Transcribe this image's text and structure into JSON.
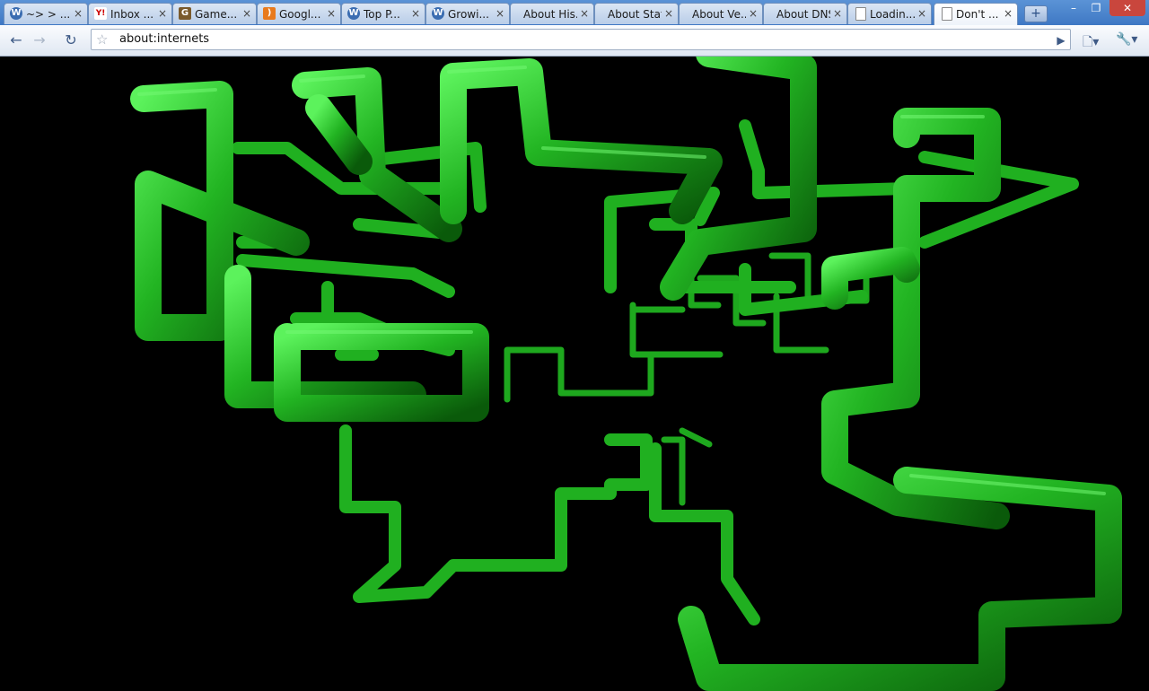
{
  "browser": {
    "tabs": [
      {
        "favicon": "wordpress-icon",
        "label": "~> > ...",
        "active": false
      },
      {
        "favicon": "yahoo-mail-icon",
        "label": "Inbox ...",
        "active": false
      },
      {
        "favicon": "gamer-icon",
        "label": "Game...",
        "active": false
      },
      {
        "favicon": "google-reader-icon",
        "label": "Googl...",
        "active": false
      },
      {
        "favicon": "wordpress-icon",
        "label": "Top P...",
        "active": false
      },
      {
        "favicon": "wordpress-icon",
        "label": "Growi...",
        "active": false
      },
      {
        "favicon": "",
        "label": "About His...",
        "active": false
      },
      {
        "favicon": "",
        "label": "About Stats",
        "active": false
      },
      {
        "favicon": "",
        "label": "About Ve...",
        "active": false
      },
      {
        "favicon": "",
        "label": "About DNS",
        "active": false
      },
      {
        "favicon": "page-icon",
        "label": "Loadin...",
        "active": false
      },
      {
        "favicon": "page-icon",
        "label": "Don't ...",
        "active": true
      }
    ],
    "tab_close_glyph": "×",
    "new_tab_glyph": "+",
    "window_controls": {
      "minimize": "–",
      "restore": "❐",
      "close": "✕"
    },
    "toolbar": {
      "back_glyph": "←",
      "forward_glyph": "→",
      "reload_glyph": "↻",
      "star_glyph": "☆",
      "go_glyph": "▶",
      "page_menu_glyph": "🗋▾",
      "wrench_menu_glyph": "🔧▾"
    },
    "address": {
      "url": "about:internets"
    }
  },
  "content": {
    "description_colors": {
      "pipe": "#22b422",
      "pipe_highlight": "#5cf25c",
      "pipe_shadow": "#0a5a0a",
      "background": "#000000"
    }
  }
}
